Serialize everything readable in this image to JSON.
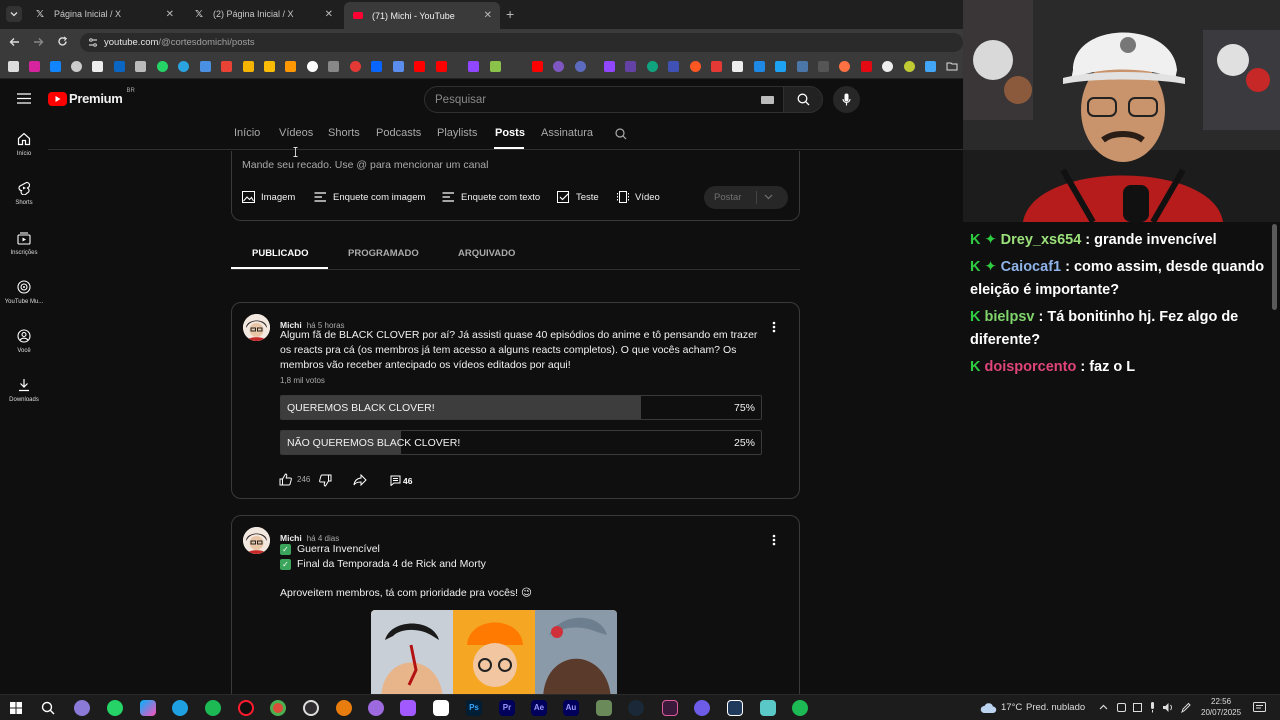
{
  "browser": {
    "tabs": [
      {
        "title": "Página Inicial / X",
        "icon": "X"
      },
      {
        "title": "(2) Página Inicial / X",
        "icon": "X"
      },
      {
        "title": "(71) Michi - YouTube",
        "icon": "youtube"
      }
    ],
    "url_domain": "youtube.com",
    "url_path": "/@cortesdomichi/posts"
  },
  "youtube": {
    "logo_text": "Premium",
    "logo_region": "BR",
    "search_placeholder": "Pesquisar",
    "sidebar": [
      {
        "label": "Início",
        "icon": "home-icon"
      },
      {
        "label": "Shorts",
        "icon": "shorts-icon"
      },
      {
        "label": "Inscrições",
        "icon": "subscriptions-icon"
      },
      {
        "label": "YouTube Mu...",
        "icon": "youtube-music-icon"
      },
      {
        "label": "Você",
        "icon": "you-icon"
      },
      {
        "label": "Downloads",
        "icon": "download-icon"
      }
    ],
    "channel_tabs": [
      "Início",
      "Vídeos",
      "Shorts",
      "Podcasts",
      "Playlists",
      "Posts",
      "Assinatura"
    ],
    "active_tab": "Posts",
    "composer": {
      "placeholder": "Mande seu recado. Use @ para mencionar um canal",
      "tools": [
        "Imagem",
        "Enquete com imagem",
        "Enquete com texto",
        "Teste",
        "Vídeo"
      ],
      "post_label": "Postar"
    },
    "filter_tabs": [
      "PUBLICADO",
      "PROGRAMADO",
      "ARQUIVADO"
    ],
    "posts": [
      {
        "author": "Michi",
        "time": "há 5 horas",
        "text": "Algum fã de BLACK CLOVER por aí? Já assisti quase 40 episódios do anime e tô pensando em trazer os reacts pra cá (os membros já tem acesso a alguns reacts completos). O que vocês acham? Os membros vão receber antecipado os vídeos editados por aqui!",
        "votes": "1,8 mil votos",
        "poll": [
          {
            "label": "QUEREMOS BLACK CLOVER!",
            "pct": "75%",
            "fraction": 0.75
          },
          {
            "label": "NÃO QUEREMOS BLACK CLOVER!",
            "pct": "25%",
            "fraction": 0.25
          }
        ],
        "likes": "246",
        "comments": "46"
      },
      {
        "author": "Michi",
        "time": "há 4 dias",
        "lines": [
          "Guerra Invencível",
          "Final da Temporada 4 de Rick and Morty"
        ],
        "text2": "Aproveitem membros, tá com prioridade pra vocês! 😉"
      }
    ]
  },
  "chat": [
    {
      "user": "Drey_xs654",
      "color": "#9be07a",
      "message": "grande invencível",
      "badges": 2
    },
    {
      "user": "Caiocaf1",
      "color": "#8fb3e8",
      "message": "como assim, desde quando eleição é importante?",
      "badges": 2
    },
    {
      "user": "bielpsv",
      "color": "#7fd46b",
      "message": "Tá bonitinho hj. Fez algo de diferente?",
      "badges": 1
    },
    {
      "user": "doisporcento",
      "color": "#e0447a",
      "message": "faz o L",
      "badges": 1
    }
  ],
  "taskbar": {
    "weather": "17°C",
    "weather_desc": "Pred. nublado",
    "time": "22:56",
    "date": "20/07/2025"
  },
  "colors": {
    "youtube_red": "#ff0000",
    "chat_badge_green": "#2ecc40",
    "background": "#0f0f0f"
  }
}
